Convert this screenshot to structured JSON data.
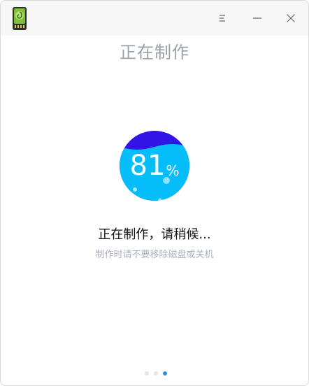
{
  "window": {
    "title": "正在制作",
    "menu_icon": "menu-icon",
    "minimize_icon": "minimize-icon",
    "close_icon": "close-icon"
  },
  "progress": {
    "value": "81",
    "unit": "%",
    "fraction": 0.81
  },
  "status": {
    "message": "正在制作，请稍候...",
    "hint": "制作时请不要移除磁盘或关机"
  },
  "pager": {
    "count": 3,
    "active_index": 2
  },
  "colors": {
    "accent": "#2f8ee8",
    "wave_fill": "#05bdf9",
    "wave_top": "#3214e6"
  }
}
